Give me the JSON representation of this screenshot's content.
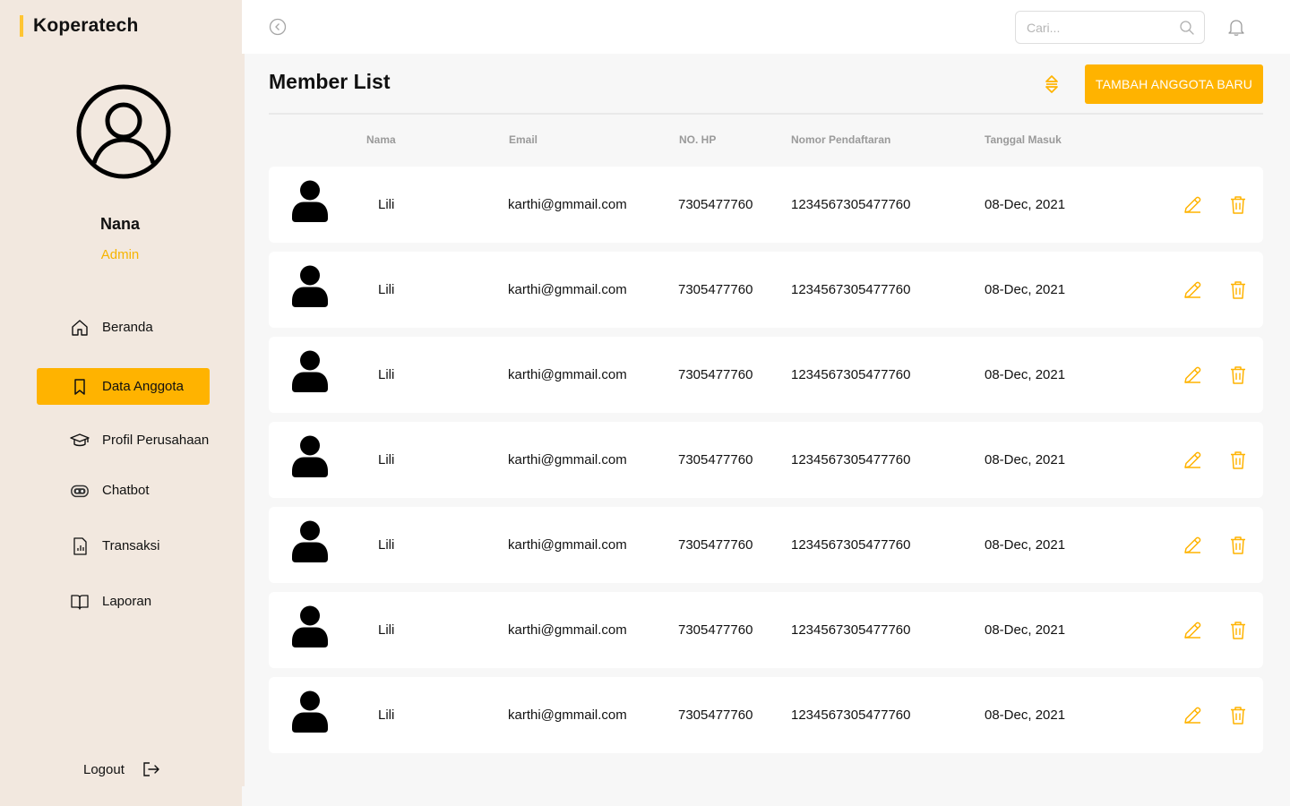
{
  "app": {
    "brand": "Koperatech",
    "accent_color": "#ffb300",
    "brand_bar_color": "#ffc533"
  },
  "profile": {
    "name": "Nana",
    "role": "Admin",
    "avatar_icon": "user-circle-icon"
  },
  "sidebar": {
    "items": [
      {
        "label": "Beranda",
        "icon": "home-icon",
        "active": false
      },
      {
        "label": "Data Anggota",
        "icon": "bookmark-icon",
        "active": true
      },
      {
        "label": "Profil Perusahaan",
        "icon": "graduation-cap-icon",
        "active": false
      },
      {
        "label": "Chatbot",
        "icon": "robot-icon",
        "active": false
      },
      {
        "label": "Transaksi",
        "icon": "receipt-icon",
        "active": false
      },
      {
        "label": "Laporan",
        "icon": "book-icon",
        "active": false
      }
    ],
    "logout_label": "Logout"
  },
  "topbar": {
    "search_placeholder": "Cari..."
  },
  "main": {
    "title": "Member List",
    "add_button_label": "TAMBAH ANGGOTA BARU",
    "columns": [
      "Nama",
      "Email",
      "NO. HP",
      "Nomor Pendaftaran",
      "Tanggal Masuk"
    ],
    "rows": [
      {
        "nama": "Lili",
        "email": "karthi@gmmail.com",
        "no_hp": "7305477760",
        "nomor_pendaftaran": "1234567305477760",
        "tanggal_masuk": "08-Dec, 2021"
      },
      {
        "nama": "Lili",
        "email": "karthi@gmmail.com",
        "no_hp": "7305477760",
        "nomor_pendaftaran": "1234567305477760",
        "tanggal_masuk": "08-Dec, 2021"
      },
      {
        "nama": "Lili",
        "email": "karthi@gmmail.com",
        "no_hp": "7305477760",
        "nomor_pendaftaran": "1234567305477760",
        "tanggal_masuk": "08-Dec, 2021"
      },
      {
        "nama": "Lili",
        "email": "karthi@gmmail.com",
        "no_hp": "7305477760",
        "nomor_pendaftaran": "1234567305477760",
        "tanggal_masuk": "08-Dec, 2021"
      },
      {
        "nama": "Lili",
        "email": "karthi@gmmail.com",
        "no_hp": "7305477760",
        "nomor_pendaftaran": "1234567305477760",
        "tanggal_masuk": "08-Dec, 2021"
      },
      {
        "nama": "Lili",
        "email": "karthi@gmmail.com",
        "no_hp": "7305477760",
        "nomor_pendaftaran": "1234567305477760",
        "tanggal_masuk": "08-Dec, 2021"
      },
      {
        "nama": "Lili",
        "email": "karthi@gmmail.com",
        "no_hp": "7305477760",
        "nomor_pendaftaran": "1234567305477760",
        "tanggal_masuk": "08-Dec, 2021"
      }
    ]
  }
}
